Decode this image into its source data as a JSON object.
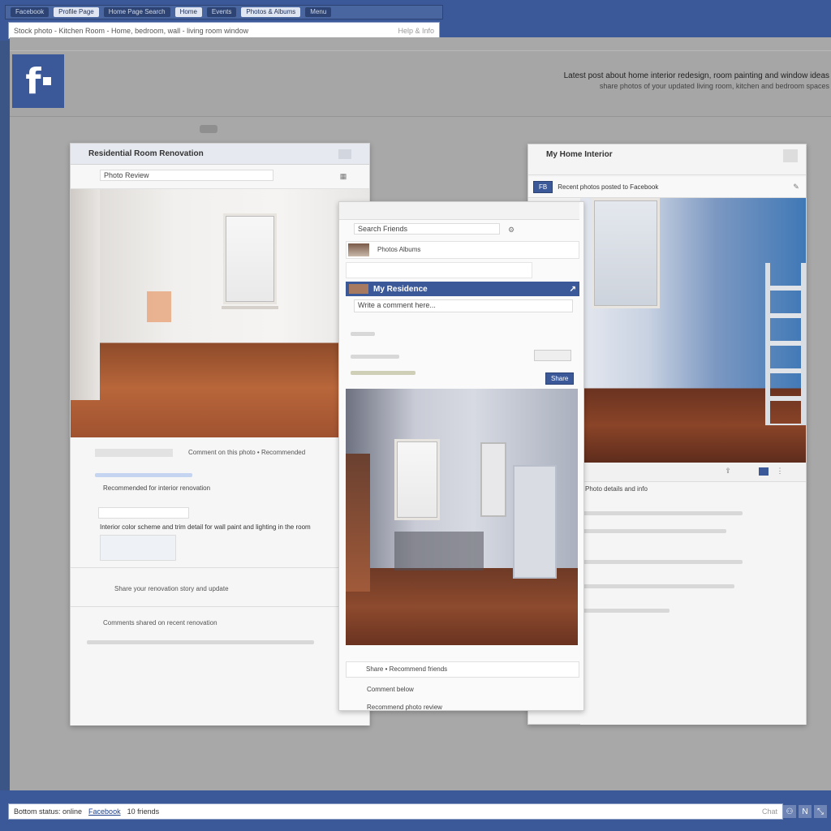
{
  "browser": {
    "tabs": [
      "Facebook",
      "Profile Page",
      "Home Page Search",
      "Home",
      "Events",
      "Photos & Albums",
      "Menu"
    ],
    "address": "Stock photo - Kitchen Room - Home, bedroom, wall - living room window",
    "address_right": "Help & Info"
  },
  "header": {
    "logo": "f",
    "line1": "Latest post about home interior redesign, room painting and window ideas",
    "line2": "share photos of your updated living room, kitchen and bedroom spaces"
  },
  "left_window": {
    "title": "Residential Room Renovation",
    "search_value": "Photo Review",
    "body_line1": "Comment on this photo • Recommended",
    "body_line2": "Recommended for interior renovation",
    "body_line3": "Interior color scheme and trim detail for wall paint and lighting in the room",
    "body_line4": "Share your renovation story and update",
    "body_line5": "Comments shared on recent renovation"
  },
  "center_window": {
    "search_value": "Search Friends",
    "row1": "Photos Albums",
    "blue_title": "My Residence",
    "input_value": "Write a comment here...",
    "button": "Share",
    "footer1": "Share • Recommend friends",
    "footer2": "Comment below",
    "footer3": "Recommend photo review"
  },
  "right_window": {
    "title": "My Home Interior",
    "sub_badge": "FB",
    "sub_text": "Recent photos posted to Facebook",
    "caption": "Photo details and info"
  },
  "bottom": {
    "label": "Bottom status: online",
    "link": "Facebook",
    "status": "10 friends",
    "right_small": "Chat"
  }
}
